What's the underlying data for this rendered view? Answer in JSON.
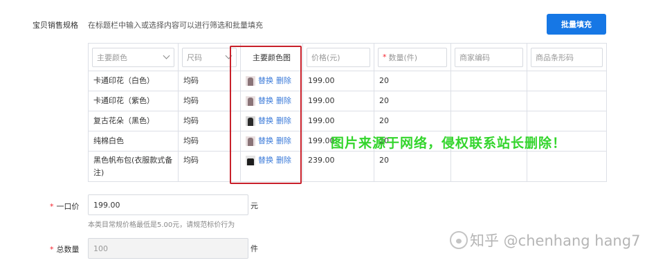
{
  "section": {
    "label": "宝贝销售规格",
    "tip": "在标题栏中输入或选择内容可以进行筛选和批量填充",
    "bulk_button": "批量填充"
  },
  "table": {
    "headers": {
      "color": "主要颜色",
      "size": "尺码",
      "color_image": "主要颜色图",
      "price": "价格(元)",
      "quantity_required": "*",
      "quantity": "数量(件)",
      "merchant_code": "商家编码",
      "barcode": "商品条形码"
    },
    "rows": [
      {
        "color": "卡通印花（白色）",
        "size": "均码",
        "replace": "替换",
        "delete": "删除",
        "price": "199.00",
        "quantity": "20",
        "merchant_code": "",
        "barcode": ""
      },
      {
        "color": "卡通印花（紫色）",
        "size": "均码",
        "replace": "替换",
        "delete": "删除",
        "price": "199.00",
        "quantity": "20",
        "merchant_code": "",
        "barcode": ""
      },
      {
        "color": "复古花朵（黑色）",
        "size": "均码",
        "replace": "替换",
        "delete": "删除",
        "price": "199.00",
        "quantity": "20",
        "merchant_code": "",
        "barcode": ""
      },
      {
        "color": "纯棉白色",
        "size": "均码",
        "replace": "替换",
        "delete": "删除",
        "price": "199.00",
        "quantity": "20",
        "merchant_code": "",
        "barcode": ""
      },
      {
        "color": "黑色帆布包(衣服款式备注)",
        "size": "均码",
        "replace": "替换",
        "delete": "删除",
        "price": "239.00",
        "quantity": "20",
        "merchant_code": "",
        "barcode": ""
      }
    ]
  },
  "price_field": {
    "required_mark": "*",
    "label": "一口价",
    "value": "199.00",
    "unit": "元",
    "hint": "本类目常规价格最低是5.00元，请规范标价行为"
  },
  "total_field": {
    "required_mark": "*",
    "label": "总数量",
    "value": "100",
    "unit": "件"
  },
  "watermark": "图片来源于网络，侵权联系站长删除！",
  "credit": "知乎 @chenhang hang7",
  "colors": {
    "primary": "#1677e5",
    "link": "#3a7ad9",
    "required": "#f5222d",
    "highlight_box": "#c8202a",
    "watermark": "#33d52c"
  }
}
